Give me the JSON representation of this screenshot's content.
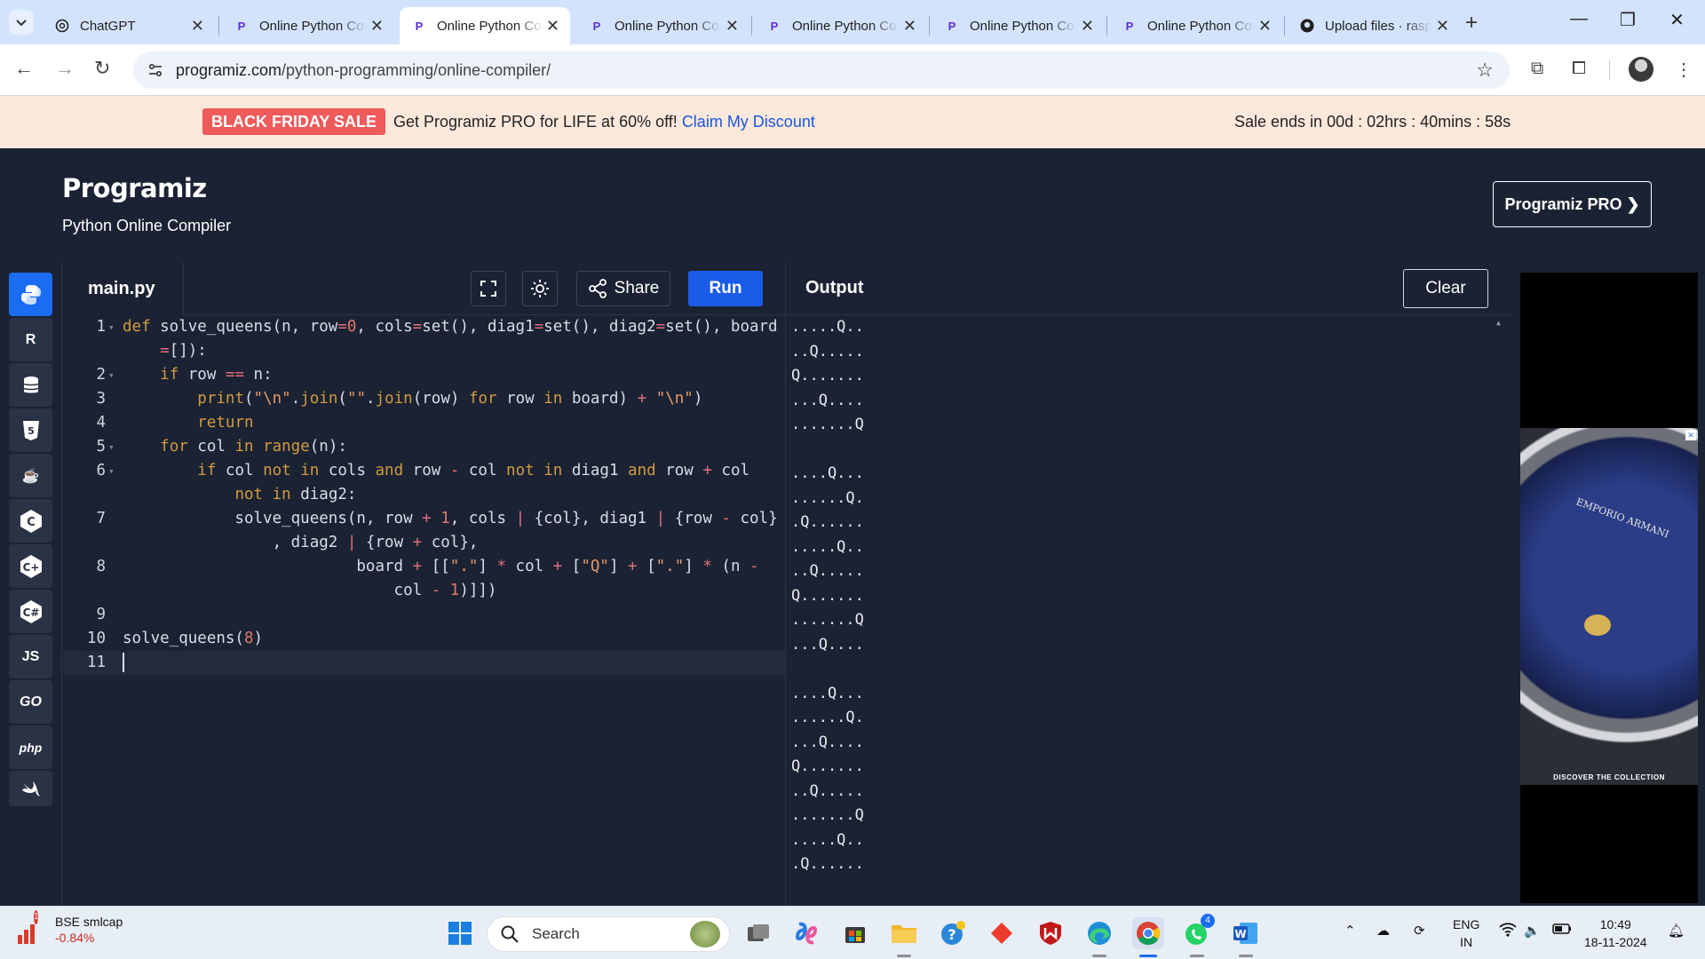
{
  "browser": {
    "tabs": [
      {
        "title": "ChatGPT"
      },
      {
        "title": "Online Python Compiler"
      },
      {
        "title": "Online Python Compiler"
      },
      {
        "title": "Online Python Compiler"
      },
      {
        "title": "Online Python Compiler"
      },
      {
        "title": "Online Python Compiler"
      },
      {
        "title": "Online Python Compiler"
      },
      {
        "title": "Upload files · raspberry"
      }
    ],
    "url_domain": "programiz.com",
    "url_path": "/python-programming/online-compiler/"
  },
  "promo": {
    "badge": "BLACK FRIDAY SALE",
    "message": "Get Programiz PRO for LIFE at 60% off!",
    "link": "Claim My Discount",
    "timer": "Sale ends in 00d : 02hrs : 40mins : 58s"
  },
  "header": {
    "logo": "Programiz",
    "subtitle": "Python Online Compiler",
    "pro_button": "Programiz PRO ❯"
  },
  "languages": [
    "python",
    "r",
    "sql",
    "html",
    "java",
    "c",
    "cpp",
    "csharp",
    "JS",
    "GO",
    "php",
    "swift"
  ],
  "editor": {
    "file_name": "main.py",
    "share_label": "Share",
    "run_label": "Run",
    "line_numbers": [
      "1",
      "",
      "2",
      "3",
      "4",
      "5",
      "6",
      "",
      "7",
      "",
      "8",
      "",
      "9",
      "10",
      "11"
    ]
  },
  "output": {
    "title": "Output",
    "clear_label": "Clear",
    "lines": [
      ".....Q..",
      "..Q.....",
      "Q.......",
      "...Q....",
      ".......Q",
      "",
      "....Q...",
      "......Q.",
      ".Q......",
      ".....Q..",
      "..Q.....",
      "Q.......",
      ".......Q",
      "...Q....",
      "",
      "....Q...",
      "......Q.",
      "...Q....",
      "Q.......",
      "..Q.....",
      ".......Q",
      ".....Q..",
      ".Q......"
    ]
  },
  "ad": {
    "brand": "EMPORIO ARMANI",
    "cta": "DISCOVER THE COLLECTION"
  },
  "taskbar": {
    "stock_name": "BSE smlcap",
    "stock_change": "-0.84%",
    "stock_badge": "1",
    "search_label": "Search",
    "whatsapp_badge": "4",
    "lang_top": "ENG",
    "lang_bottom": "IN",
    "time": "10:49",
    "date": "18-11-2024"
  }
}
